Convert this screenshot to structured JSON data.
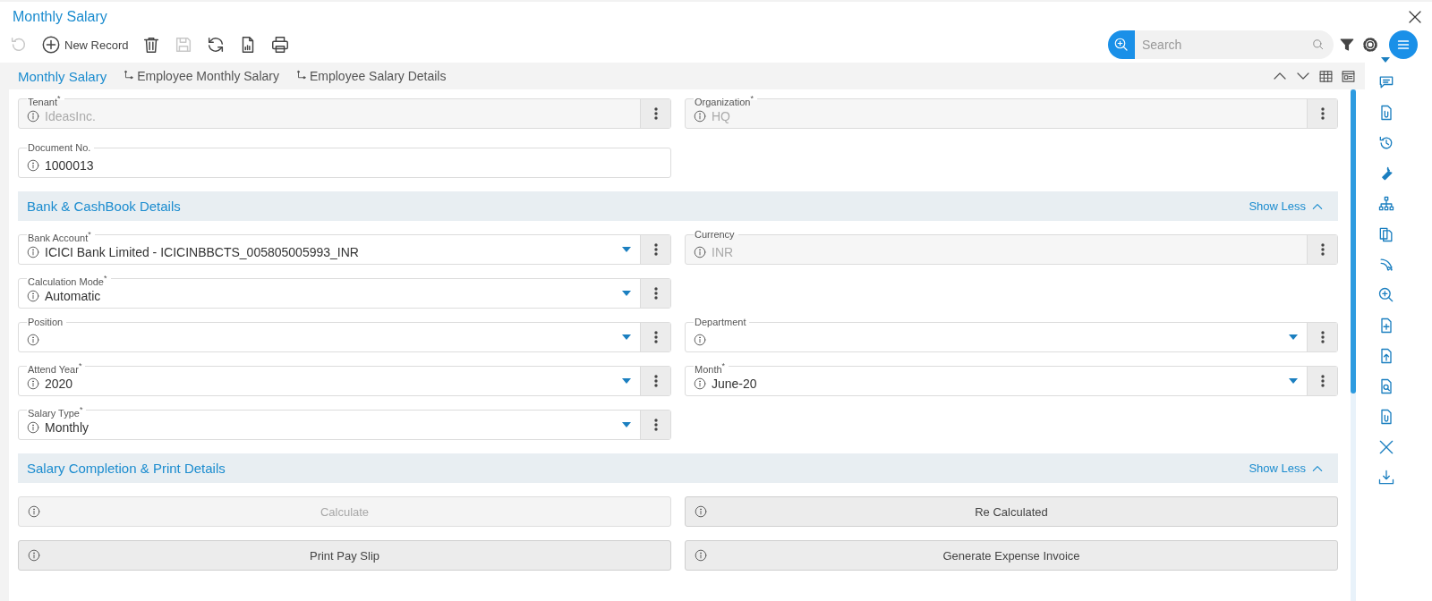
{
  "window": {
    "title": "Monthly Salary"
  },
  "toolbar": [
    {
      "kind": "undo",
      "disabled": true
    },
    {
      "kind": "new",
      "label": "New Record",
      "disabled": false
    },
    {
      "kind": "delete",
      "disabled": false
    },
    {
      "kind": "save",
      "disabled": true
    },
    {
      "kind": "refresh",
      "disabled": false
    },
    {
      "kind": "report",
      "disabled": false
    },
    {
      "kind": "print",
      "disabled": false
    }
  ],
  "search": {
    "placeholder": "Search"
  },
  "tabs": [
    {
      "label": "Monthly Salary",
      "selected": true,
      "kind": "main"
    },
    {
      "label": "Employee Monthly Salary",
      "selected": false,
      "kind": "child"
    },
    {
      "label": "Employee Salary Details",
      "selected": false,
      "kind": "child"
    }
  ],
  "header_rows": [
    {
      "left": {
        "label": "Tenant",
        "required_mark": "*",
        "value": "IdeasInc.",
        "disabled": true,
        "dropdown": false
      },
      "right": {
        "label": "Organization",
        "required_mark": "*",
        "value": "HQ",
        "disabled": true,
        "dropdown": false
      }
    },
    {
      "left": {
        "label": "Document No.",
        "value": "1000013",
        "disabled": false,
        "dropdown": false,
        "kebab": false
      }
    }
  ],
  "sections": [
    {
      "title": "Bank & CashBook Details",
      "toggle": "Show Less",
      "expanded": true,
      "rows": [
        {
          "left": {
            "label": "Bank Account",
            "required_mark": "*",
            "value": "ICICI Bank Limited - ICICINBBCTS_005805005993_INR",
            "disabled": false,
            "dropdown": true
          },
          "right": {
            "label": "Currency",
            "value": "INR",
            "disabled": true,
            "dropdown": false
          }
        },
        {
          "left": {
            "label": "Calculation Mode",
            "required_mark": "*",
            "value": "Automatic",
            "disabled": false,
            "dropdown": true
          }
        },
        {
          "left": {
            "label": "Position",
            "disabled": false,
            "dropdown": true
          },
          "right": {
            "label": "Department",
            "disabled": false,
            "dropdown": true
          }
        },
        {
          "left": {
            "label": "Attend Year",
            "required_mark": "*",
            "value": "2020",
            "disabled": false,
            "dropdown": true
          },
          "right": {
            "label": "Month",
            "required_mark": "*",
            "value": "June-20",
            "disabled": false,
            "dropdown": true
          }
        },
        {
          "left": {
            "label": "Salary Type",
            "required_mark": "*",
            "value": "Monthly",
            "disabled": false,
            "dropdown": true
          }
        }
      ]
    },
    {
      "title": "Salary Completion & Print Details",
      "toggle": "Show Less",
      "expanded": true,
      "button_rows": [
        {
          "left": {
            "label": "Calculate",
            "disabled": true
          },
          "right": {
            "label": "Re Calculated",
            "disabled": false
          }
        },
        {
          "left": {
            "label": "Print Pay Slip",
            "disabled": false
          },
          "right": {
            "label": "Generate Expense Invoice",
            "disabled": false
          }
        }
      ]
    }
  ]
}
